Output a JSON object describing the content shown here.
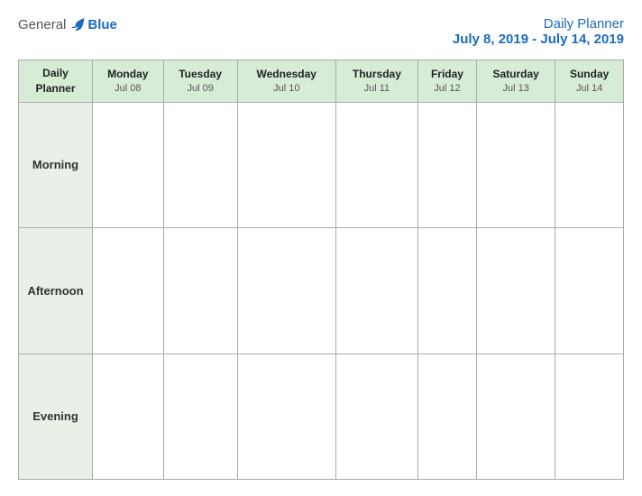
{
  "header": {
    "logo": {
      "general": "General",
      "blue": "Blue"
    },
    "title": "Daily Planner",
    "date_range": "July 8, 2019 - July 14, 2019"
  },
  "table": {
    "header_label": "Daily\nPlanner",
    "days": [
      {
        "name": "Monday",
        "date": "Jul 08"
      },
      {
        "name": "Tuesday",
        "date": "Jul 09"
      },
      {
        "name": "Wednesday",
        "date": "Jul 10"
      },
      {
        "name": "Thursday",
        "date": "Jul 11"
      },
      {
        "name": "Friday",
        "date": "Jul 12"
      },
      {
        "name": "Saturday",
        "date": "Jul 13"
      },
      {
        "name": "Sunday",
        "date": "Jul 14"
      }
    ],
    "rows": [
      {
        "label": "Morning"
      },
      {
        "label": "Afternoon"
      },
      {
        "label": "Evening"
      }
    ]
  }
}
